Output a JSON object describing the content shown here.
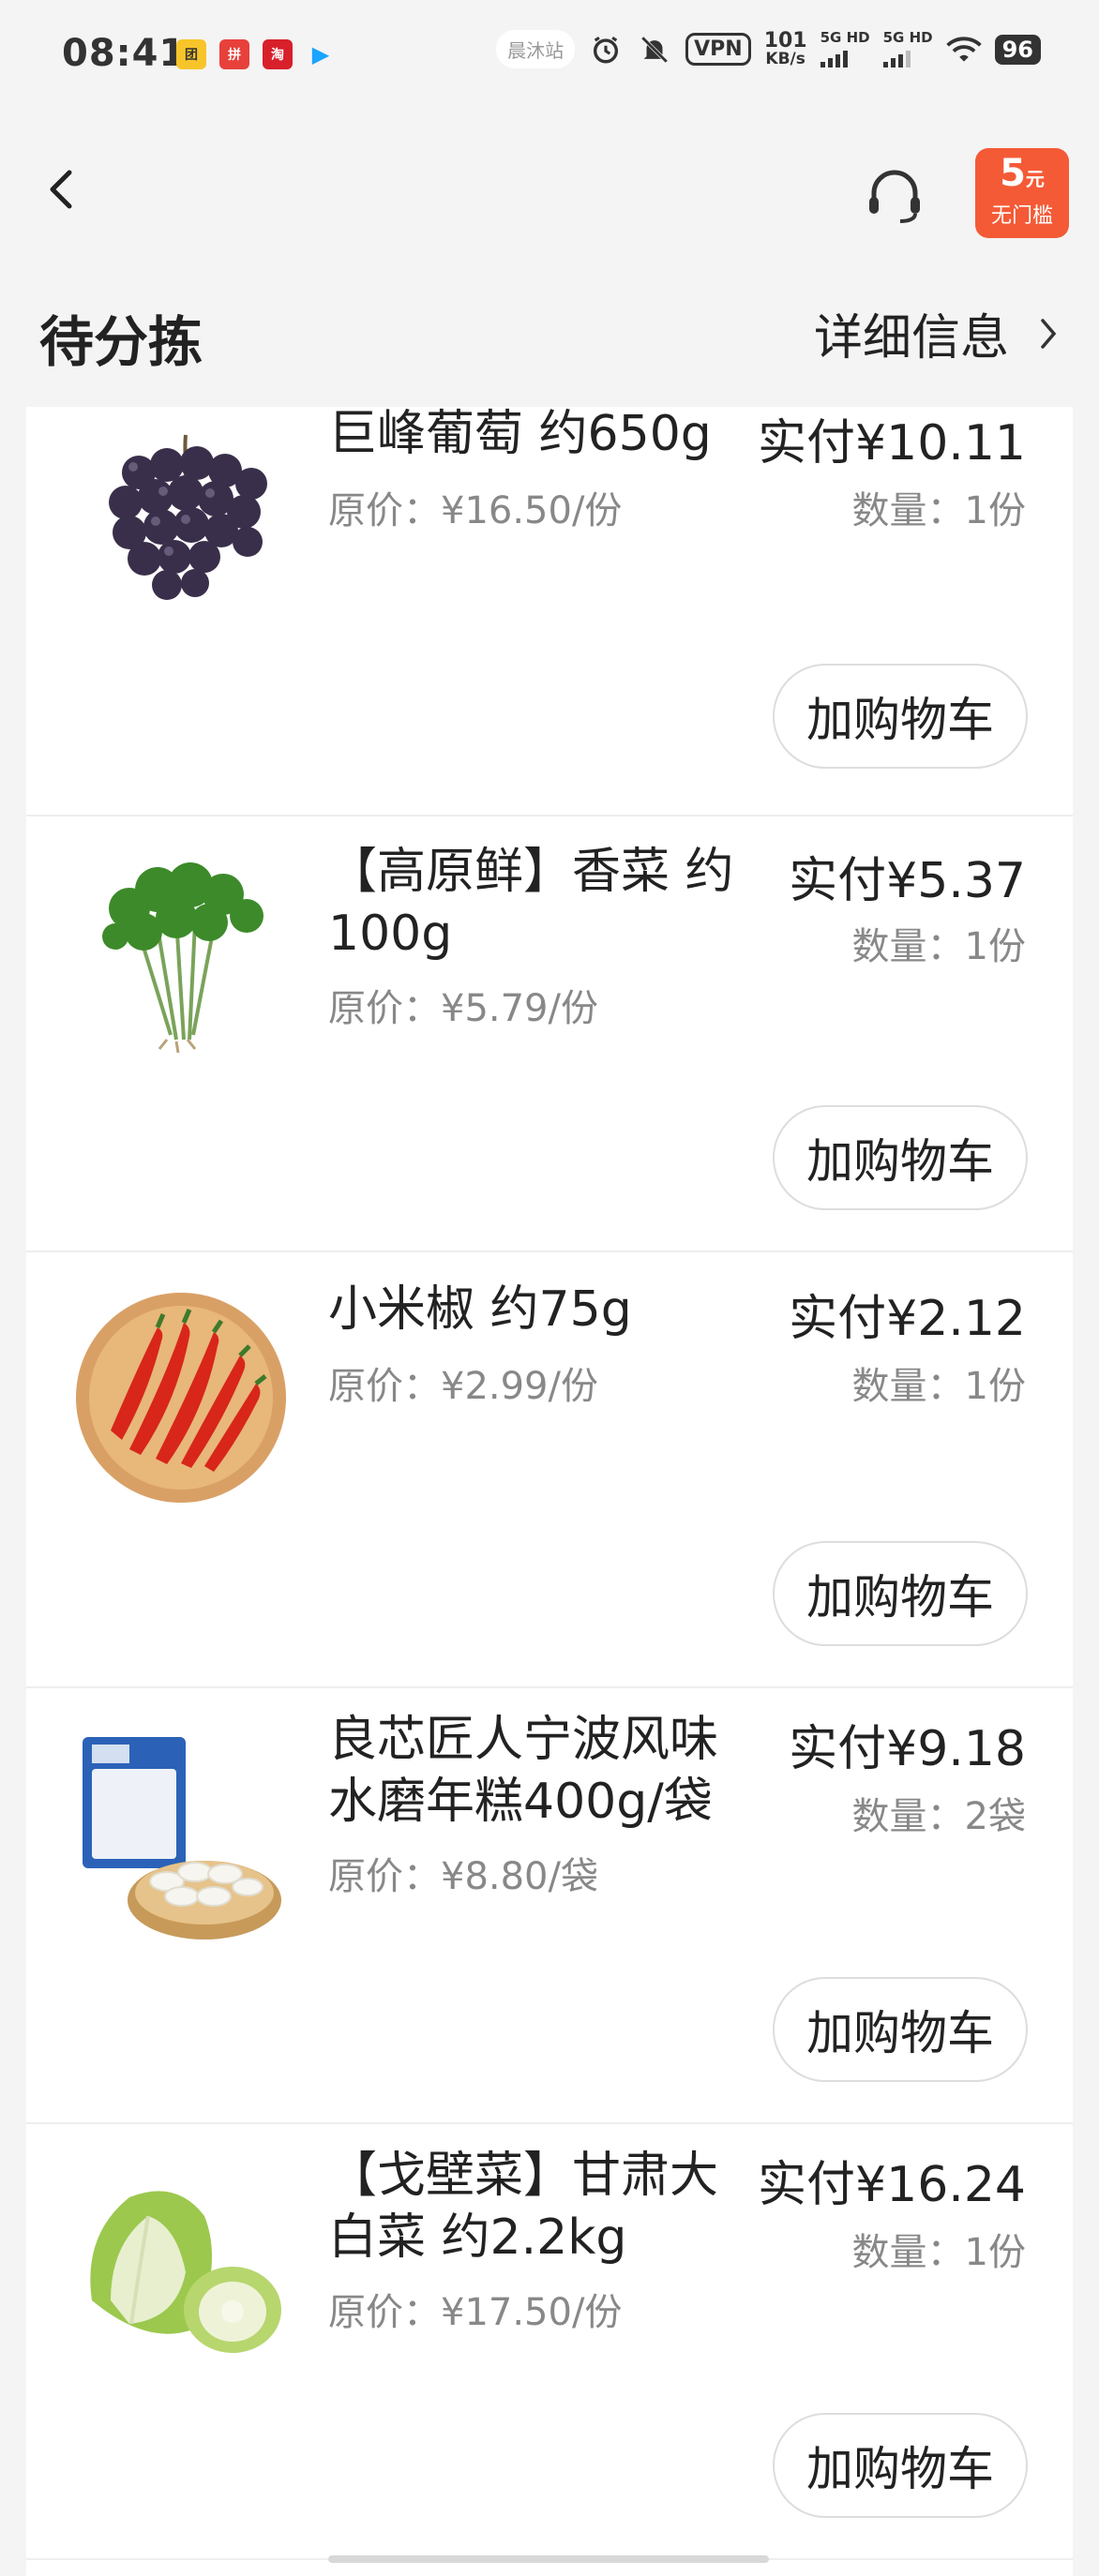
{
  "status_bar": {
    "time": "08:41",
    "apps": [
      {
        "icon": "tuan-app-icon",
        "label": "团",
        "color": "#f7c52a"
      },
      {
        "icon": "pdd-app-icon",
        "label": "拼",
        "color": "#e8403b"
      },
      {
        "icon": "shop-app-icon",
        "label": "淘",
        "color": "#d8202a"
      },
      {
        "icon": "play-app-icon",
        "label": "▶",
        "color": "#ffffff"
      }
    ],
    "station_chip": "晨沐站",
    "vpn": "VPN",
    "speed_value": "101",
    "speed_unit": "KB/s",
    "sim1": "5G HD",
    "sim2": "5G HD",
    "battery": "96"
  },
  "nav": {
    "coupon_amount": "5",
    "coupon_unit": "元",
    "coupon_desc": "无门槛"
  },
  "section": {
    "title": "待分拣",
    "detail_link": "详细信息"
  },
  "items": [
    {
      "name": "巨峰葡萄 约650g",
      "original_price": "原价：¥16.50/份",
      "paid": "实付¥10.11",
      "qty": "数量：1份",
      "cart": "加购物车",
      "thumb": "grapes"
    },
    {
      "name": "【高原鲜】香菜 约100g",
      "original_price": "原价：¥5.79/份",
      "paid": "实付¥5.37",
      "qty": "数量：1份",
      "cart": "加购物车",
      "thumb": "cilantro"
    },
    {
      "name": "小米椒 约75g",
      "original_price": "原价：¥2.99/份",
      "paid": "实付¥2.12",
      "qty": "数量：1份",
      "cart": "加购物车",
      "thumb": "chili"
    },
    {
      "name": "良芯匠人宁波风味水磨年糕400g/袋",
      "original_price": "原价：¥8.80/袋",
      "paid": "实付¥9.18",
      "qty": "数量：2袋",
      "cart": "加购物车",
      "thumb": "ricecake"
    },
    {
      "name": "【戈壁菜】甘肃大白菜 约2.2kg",
      "original_price": "原价：¥17.50/份",
      "paid": "实付¥16.24",
      "qty": "数量：1份",
      "cart": "加购物车",
      "thumb": "cabbage"
    }
  ]
}
